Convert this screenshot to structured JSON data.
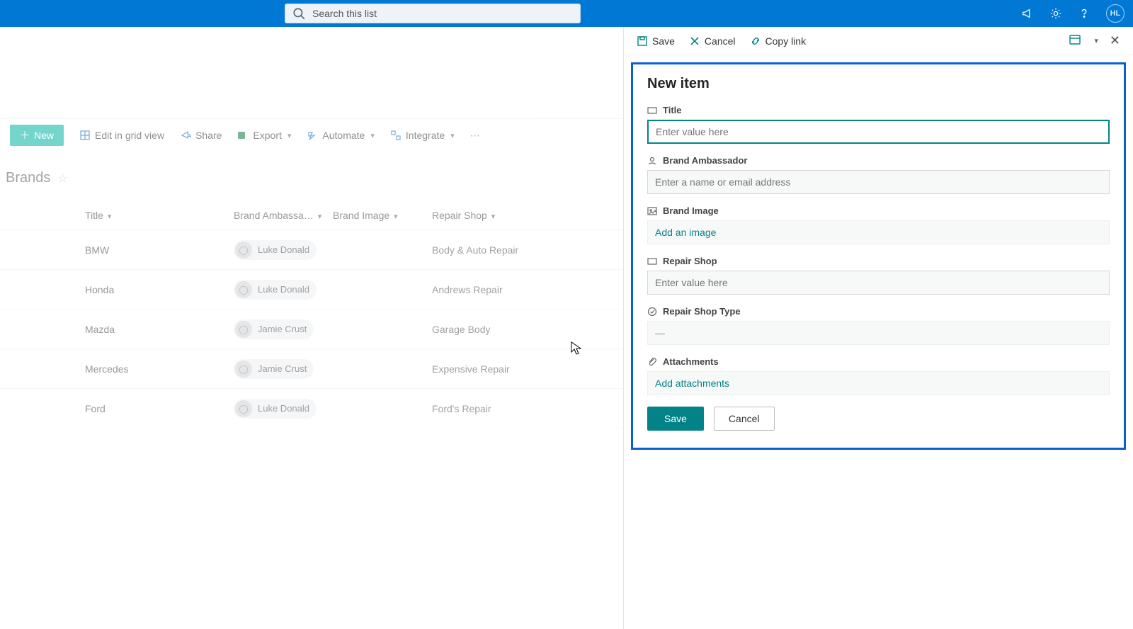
{
  "suite": {
    "search_placeholder": "Search this list",
    "avatar_initials": "HL"
  },
  "panel_cmdbar": {
    "save": "Save",
    "cancel": "Cancel",
    "copylink": "Copy link"
  },
  "list_cmdbar": {
    "new": "New",
    "edit_grid": "Edit in grid view",
    "share": "Share",
    "export": "Export",
    "automate": "Automate",
    "integrate": "Integrate"
  },
  "list": {
    "title": "Brands",
    "columns": {
      "title": "Title",
      "brand_ambassador": "Brand Ambassa…",
      "brand_image": "Brand Image",
      "repair_shop": "Repair Shop"
    },
    "rows": [
      {
        "title": "BMW",
        "person": "Luke Donald",
        "repair": "Body & Auto Repair",
        "thumb": "b1"
      },
      {
        "title": "Honda",
        "person": "Luke Donald",
        "repair": "Andrews Repair",
        "thumb": "b2"
      },
      {
        "title": "Mazda",
        "person": "Jamie Crust",
        "repair": "Garage Body",
        "thumb": "b3"
      },
      {
        "title": "Mercedes",
        "person": "Jamie Crust",
        "repair": "Expensive Repair",
        "thumb": "b4"
      },
      {
        "title": "Ford",
        "person": "Luke Donald",
        "repair": "Ford's Repair",
        "thumb": "b5"
      }
    ]
  },
  "panel": {
    "heading": "New item",
    "fields": {
      "title_label": "Title",
      "title_placeholder": "Enter value here",
      "ambassador_label": "Brand Ambassador",
      "ambassador_placeholder": "Enter a name or email address",
      "image_label": "Brand Image",
      "image_action": "Add an image",
      "repair_label": "Repair Shop",
      "repair_placeholder": "Enter value here",
      "repairtype_label": "Repair Shop Type",
      "repairtype_value": "—",
      "attachments_label": "Attachments",
      "attachments_action": "Add attachments"
    },
    "buttons": {
      "save": "Save",
      "cancel": "Cancel"
    }
  }
}
